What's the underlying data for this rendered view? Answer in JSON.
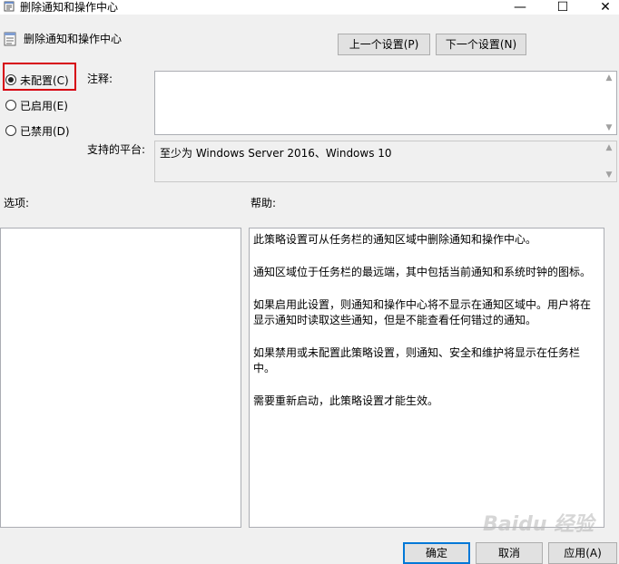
{
  "window": {
    "title": "删除通知和操作中心",
    "minimize": "—",
    "maximize": "☐",
    "close": "✕"
  },
  "header": {
    "policy_name": "删除通知和操作中心",
    "prev_button": "上一个设置(P)",
    "next_button": "下一个设置(N)"
  },
  "state": {
    "options": [
      {
        "label": "未配置(C)",
        "selected": true
      },
      {
        "label": "已启用(E)",
        "selected": false
      },
      {
        "label": "已禁用(D)",
        "selected": false
      }
    ],
    "highlight_color": "#d6000f"
  },
  "comment": {
    "label": "注释:",
    "value": ""
  },
  "platform": {
    "label": "支持的平台:",
    "value": "至少为 Windows Server 2016、Windows 10"
  },
  "options_panel": {
    "label": "选项:"
  },
  "help_panel": {
    "label": "帮助:",
    "paragraphs": [
      "此策略设置可从任务栏的通知区域中删除通知和操作中心。",
      "通知区域位于任务栏的最远端，其中包括当前通知和系统时钟的图标。",
      "如果启用此设置，则通知和操作中心将不显示在通知区域中。用户将在显示通知时读取这些通知，但是不能查看任何错过的通知。",
      "如果禁用或未配置此策略设置，则通知、安全和维护将显示在任务栏中。",
      "需要重新启动，此策略设置才能生效。"
    ]
  },
  "footer": {
    "ok": "确定",
    "cancel": "取消",
    "apply": "应用(A)"
  },
  "watermark": "Baidu 经验"
}
